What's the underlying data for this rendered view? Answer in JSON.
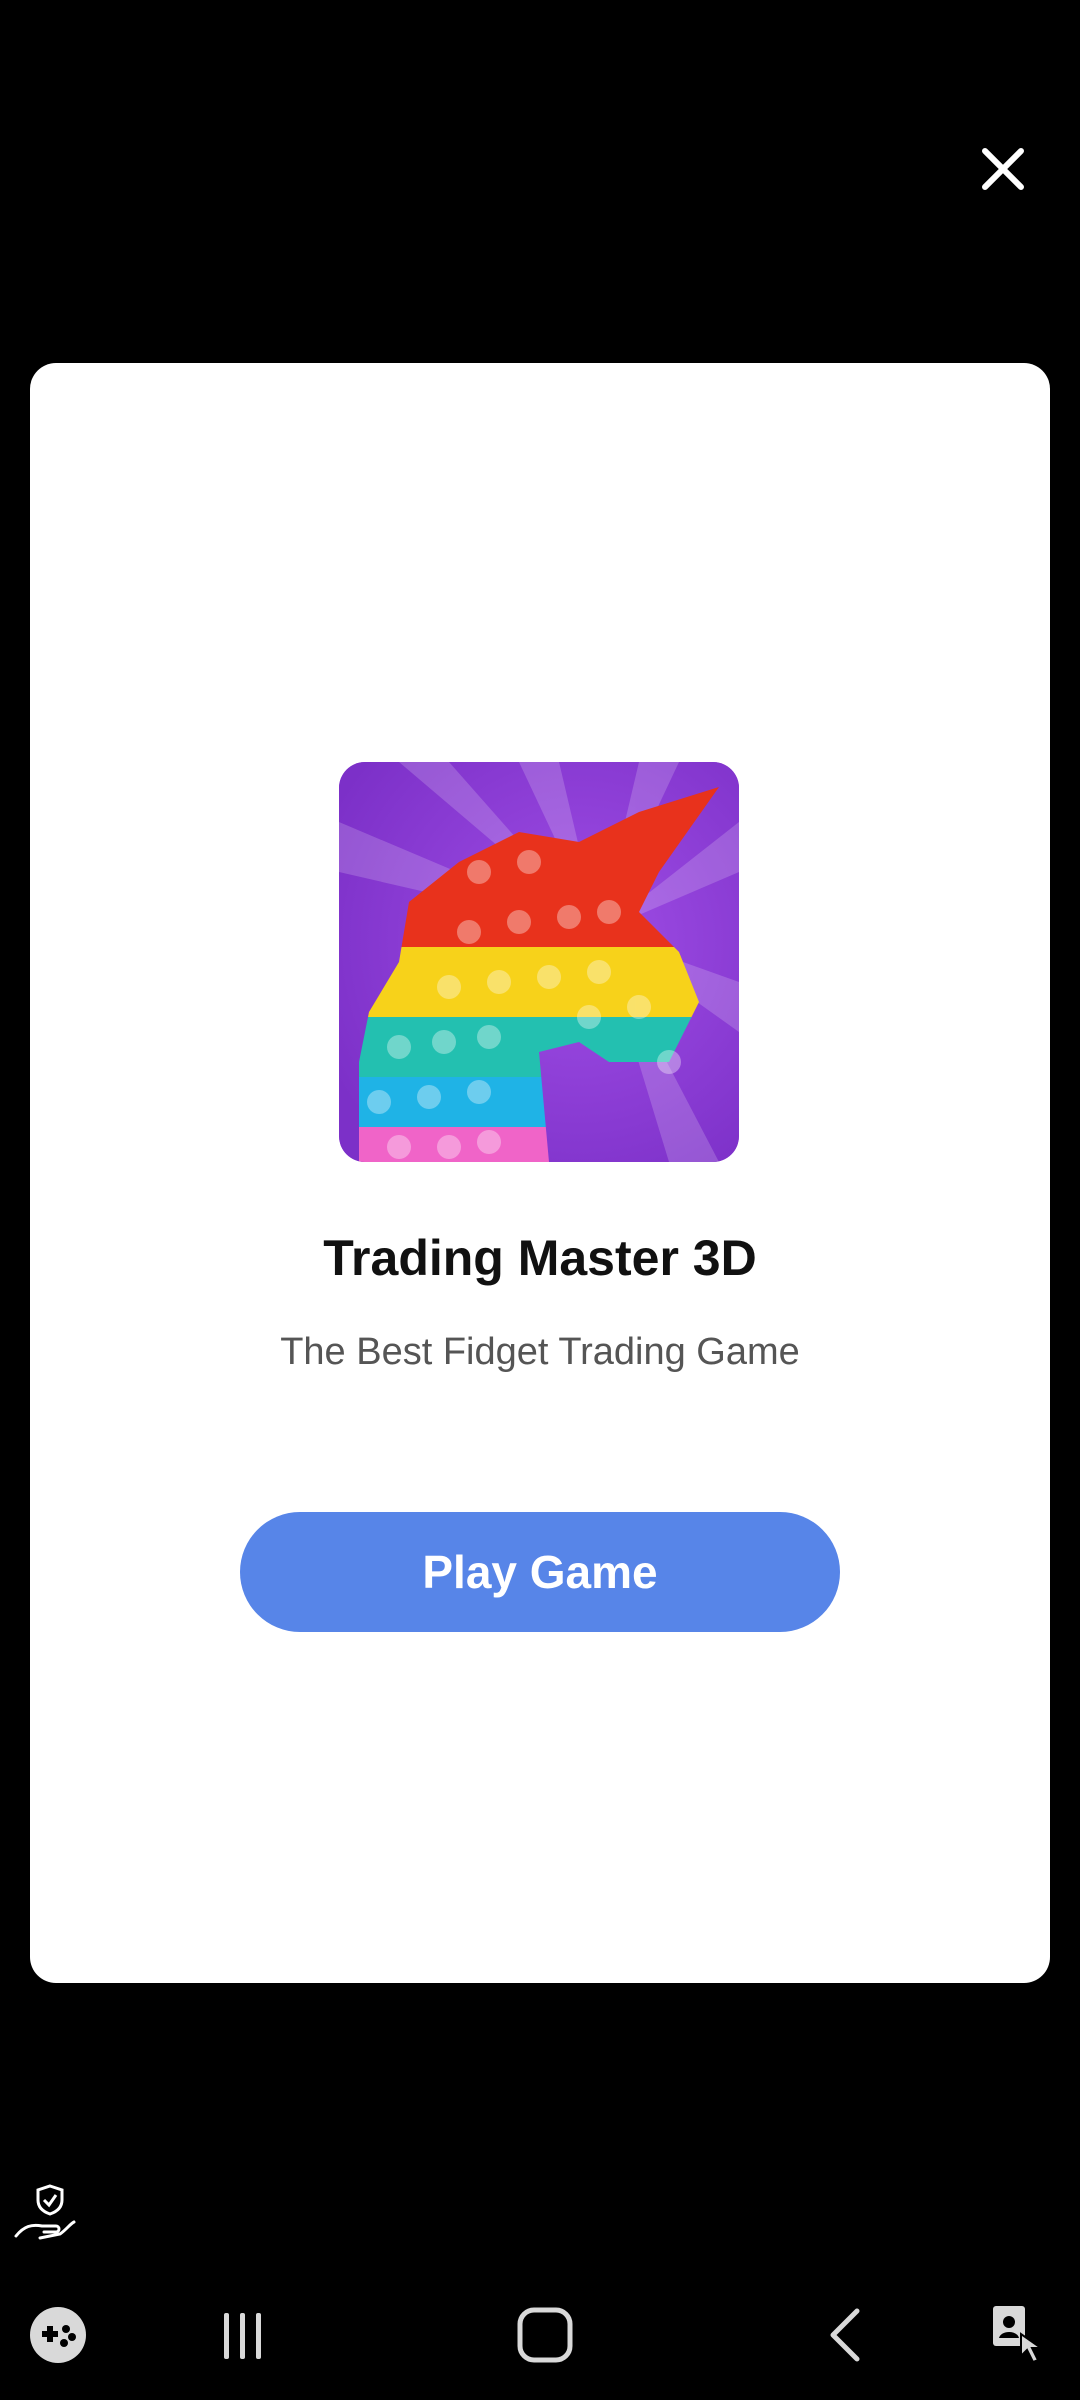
{
  "dialog": {
    "close_icon": "close-icon",
    "app_name": "Trading Master 3D",
    "tagline": "The Best Fidget Trading Game",
    "play_button_label": "Play Game",
    "button_color": "#5785e8",
    "icon_background_color": "#8b3bd6"
  },
  "overlay": {
    "privacy_icon": "hand-shield-icon"
  },
  "navbar": {
    "items": [
      {
        "icon": "game-tools-icon"
      },
      {
        "icon": "recent-apps-icon"
      },
      {
        "icon": "home-icon"
      },
      {
        "icon": "back-icon"
      },
      {
        "icon": "accessibility-icon"
      }
    ]
  }
}
